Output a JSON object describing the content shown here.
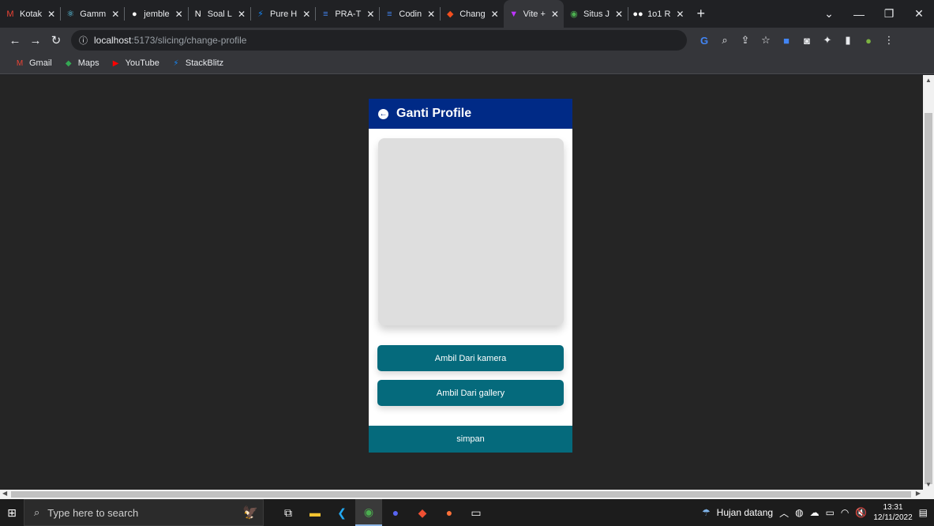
{
  "tabs": [
    {
      "label": "Kotak",
      "icon": "gmail-icon",
      "glyph": "M",
      "color": "#ea4335"
    },
    {
      "label": "Gamm",
      "icon": "react-icon",
      "glyph": "⚛",
      "color": "#61dafb"
    },
    {
      "label": "jemble",
      "icon": "github-icon",
      "glyph": "●",
      "color": "#ffffff"
    },
    {
      "label": "Soal L",
      "icon": "notion-icon",
      "glyph": "N",
      "color": "#ffffff"
    },
    {
      "label": "Pure H",
      "icon": "stackblitz-icon",
      "glyph": "⚡",
      "color": "#1389fd"
    },
    {
      "label": "PRA-T",
      "icon": "docs-icon",
      "glyph": "≡",
      "color": "#4285f4"
    },
    {
      "label": "Codin",
      "icon": "docs-icon",
      "glyph": "≡",
      "color": "#4285f4"
    },
    {
      "label": "Chang",
      "icon": "figma-icon",
      "glyph": "◆",
      "color": "#f24e1e"
    },
    {
      "label": "Vite +",
      "icon": "vite-icon",
      "glyph": "▼",
      "color": "#bd34fe"
    },
    {
      "label": "Situs J",
      "icon": "site-icon",
      "glyph": "◉",
      "color": "#4caf50"
    },
    {
      "label": "1o1 R",
      "icon": "medium-icon",
      "glyph": "●●",
      "color": "#ffffff"
    }
  ],
  "active_tab": 8,
  "address": {
    "host": "localhost",
    "path": ":5173/slicing/change-profile"
  },
  "bookmarks": [
    {
      "label": "Gmail",
      "icon": "gmail-icon",
      "glyph": "M",
      "color": "#ea4335"
    },
    {
      "label": "Maps",
      "icon": "maps-icon",
      "glyph": "◆",
      "color": "#34a853"
    },
    {
      "label": "YouTube",
      "icon": "youtube-icon",
      "glyph": "▶",
      "color": "#ff0000"
    },
    {
      "label": "StackBlitz",
      "icon": "stackblitz-icon",
      "glyph": "⚡",
      "color": "#1389fd"
    }
  ],
  "app": {
    "title": "Ganti Profile",
    "camera_button": "Ambil Dari kamera",
    "gallery_button": "Ambil Dari gallery",
    "save_button": "simpan",
    "header_color": "#002a86",
    "button_color": "#056a7c"
  },
  "taskbar": {
    "search_placeholder": "Type here to search",
    "weather": "Hujan datang",
    "time": "13:31",
    "date": "12/11/2022"
  }
}
